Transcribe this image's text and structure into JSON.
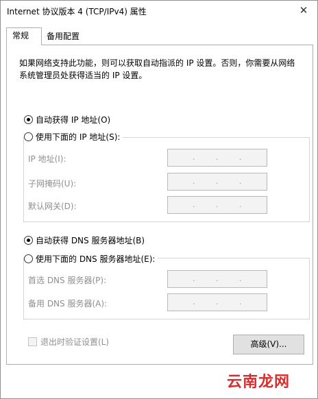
{
  "window": {
    "title": "Internet 协议版本 4 (TCP/IPv4) 属性",
    "close_glyph": "✕"
  },
  "tabs": [
    {
      "label": "常规",
      "active": true
    },
    {
      "label": "备用配置",
      "active": false
    }
  ],
  "description": "如果网络支持此功能，则可以获取自动指派的 IP 设置。否则，你需要从网络系统管理员处获得适当的 IP 设置。",
  "ip": {
    "auto_label": "自动获得 IP 地址(O)",
    "auto_checked": true,
    "manual_label": "使用下面的 IP 地址(S):",
    "manual_checked": false,
    "fields": [
      {
        "label": "IP 地址(I):",
        "value": ". . ."
      },
      {
        "label": "子网掩码(U):",
        "value": ". . ."
      },
      {
        "label": "默认网关(D):",
        "value": ". . ."
      }
    ]
  },
  "dns": {
    "auto_label": "自动获得 DNS 服务器地址(B)",
    "auto_checked": true,
    "manual_label": "使用下面的 DNS 服务器地址(E):",
    "manual_checked": false,
    "fields": [
      {
        "label": "首选 DNS 服务器(P):",
        "value": ". . ."
      },
      {
        "label": "备用 DNS 服务器(A):",
        "value": ". . ."
      }
    ]
  },
  "validate_label": "退出时验证设置(L)",
  "validate_checked": false,
  "advanced_label": "高级(V)...",
  "watermark": "云南龙网",
  "colors": {
    "watermark": "#d42e2e",
    "disabled_text": "#8f8f8f"
  }
}
